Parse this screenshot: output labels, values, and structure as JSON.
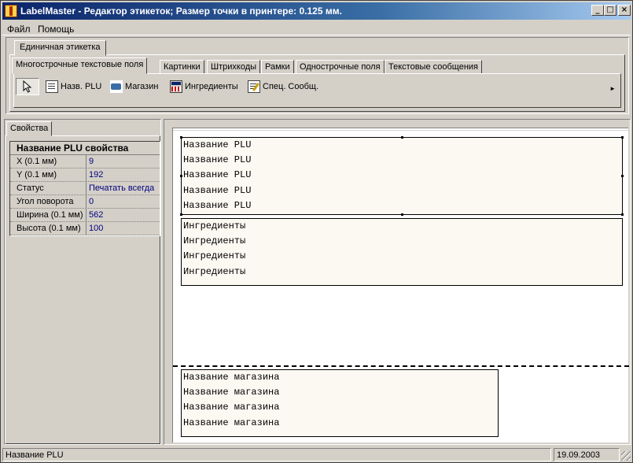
{
  "window": {
    "title": "LabelMaster - Редактор этикеток; Размер точки в принтере: 0.125 мм.",
    "min_glyph": "_",
    "max_glyph": "□",
    "close_glyph": "×"
  },
  "menu": {
    "file": "Файл",
    "help": "Помощь"
  },
  "outer_tabs": {
    "single_label": "Единичная этикетка"
  },
  "inner_tabs": [
    {
      "label": "Многострочные текстовые поля",
      "active": true
    },
    {
      "label": "Картинки"
    },
    {
      "label": "Штрихкоды"
    },
    {
      "label": "Рамки"
    },
    {
      "label": "Однострочные поля"
    },
    {
      "label": "Текстовые сообщения"
    }
  ],
  "tools": [
    {
      "label": "",
      "icon": "pointer-icon"
    },
    {
      "label": "Назв. PLU",
      "icon": "document-icon"
    },
    {
      "label": "Магазин",
      "icon": "shop-icon"
    },
    {
      "label": "Ингредиенты",
      "icon": "ingredients-icon"
    },
    {
      "label": "Спец. Сообщ.",
      "icon": "special-message-icon"
    }
  ],
  "toolbar_scroll_glyph": "►",
  "properties": {
    "tab": "Свойства",
    "header": "Название PLU свойства",
    "rows": [
      {
        "name": "X (0.1 мм)",
        "value": "9"
      },
      {
        "name": "Y (0.1 мм)",
        "value": "192"
      },
      {
        "name": "Статус",
        "value": "Печатать всегда"
      },
      {
        "name": "Угол поворота",
        "value": "0"
      },
      {
        "name": "Ширина (0.1 мм)",
        "value": "562"
      },
      {
        "name": "Высота (0.1 мм)",
        "value": "100"
      }
    ]
  },
  "canvas": {
    "plu_lines": [
      "Название PLU",
      "Название PLU",
      "Название PLU",
      "Название PLU",
      "Название PLU"
    ],
    "ingredient_lines": [
      "Ингредиенты",
      "Ингредиенты",
      "Ингредиенты",
      "Ингредиенты"
    ],
    "shop_lines": [
      "Название магазина",
      "Название магазина",
      "Название магазина",
      "Название магазина"
    ]
  },
  "status": {
    "left": "Название PLU",
    "right": "19.09.2003"
  }
}
